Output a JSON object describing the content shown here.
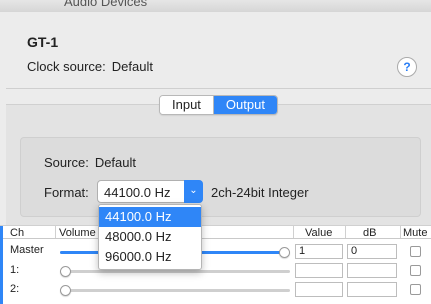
{
  "window": {
    "title": "Audio Devices"
  },
  "device": {
    "name": "GT-1",
    "clock_label": "Clock source:",
    "clock_value": "Default",
    "help_label": "?"
  },
  "tabs": [
    {
      "label": "Input",
      "selected": false
    },
    {
      "label": "Output",
      "selected": true
    }
  ],
  "output": {
    "source_label": "Source:",
    "source_value": "Default",
    "format_label": "Format:",
    "format_value": "44100.0 Hz",
    "format_detail": "2ch-24bit Integer"
  },
  "format_menu": {
    "options": [
      "44100.0 Hz",
      "48000.0 Hz",
      "96000.0 Hz"
    ],
    "selected_index": 0
  },
  "channel_table": {
    "headers": {
      "ch": "Ch",
      "volume": "Volume",
      "value": "Value",
      "db": "dB",
      "mute": "Mute"
    },
    "rows": [
      {
        "ch": "Master",
        "volume_fraction": 1.0,
        "value": "1",
        "db": "0",
        "muted": false
      },
      {
        "ch": "1:",
        "volume_fraction": 0.0,
        "value": "",
        "db": "",
        "muted": false
      },
      {
        "ch": "2:",
        "volume_fraction": 0.0,
        "value": "",
        "db": "",
        "muted": false
      }
    ]
  },
  "colors": {
    "accent": "#2f86f7"
  }
}
